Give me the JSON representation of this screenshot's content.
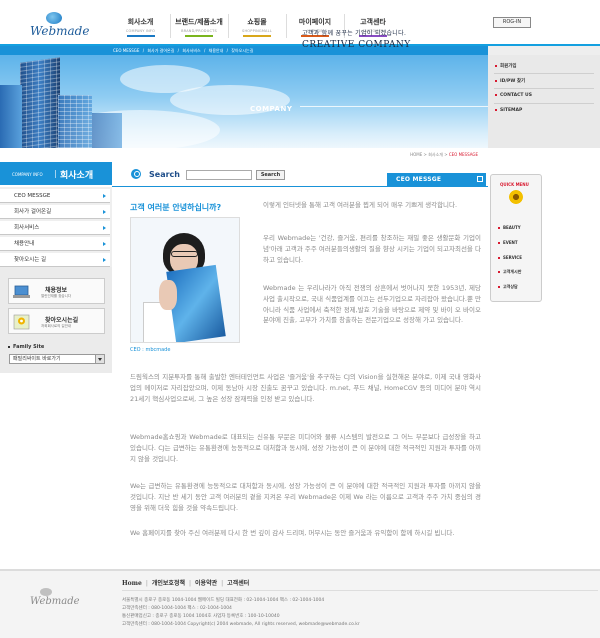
{
  "brand": {
    "logo_text": "Webmade"
  },
  "topnav": [
    {
      "ko": "회사소개",
      "en": "COMPANY INFO",
      "color": "#1a79c4"
    },
    {
      "ko": "브랜드/제품소개",
      "en": "BRAND/PRODUCTS",
      "color": "#7ab51d"
    },
    {
      "ko": "쇼핑몰",
      "en": "SHOPPINGMALL",
      "color": "#d8a71a"
    },
    {
      "ko": "마이페이지",
      "en": "MYPAGE",
      "color": "#d85a1a"
    },
    {
      "ko": "고객센타",
      "en": "CUSTOMER",
      "color": "#8a4dc4"
    }
  ],
  "login_label": "ROG-IN",
  "subnav": [
    "CEO MESSGE",
    "/",
    "회사가 걸어온길",
    "/",
    "회사서비스",
    "/",
    "채용안내",
    "/",
    "찾아오시는길"
  ],
  "banner": {
    "line1": "고객과 함께 꿈꾸는 기업이 되겠습니다.",
    "line2": "CREATIVE COMPANY",
    "company": "COMPANY"
  },
  "right_menu": [
    "회원가입",
    "ID/PW 찾기",
    "CONTACT US",
    "SITEMAP"
  ],
  "breadcrumb": {
    "home": "HOME",
    "sep": " > ",
    "mid": "회사소개",
    "current": "CEO MESSAGE"
  },
  "left": {
    "header_en": "COMPANY INFO",
    "header_ko": "회사소개",
    "menu": [
      "CEO MESSGE",
      "회사가 걸어온길",
      "회사서비스",
      "채용안내",
      "찾아오시는 길"
    ],
    "buttons": [
      {
        "title": "채용정보",
        "sub": "열린인재를 찾습니다"
      },
      {
        "title": "찾아오시는길",
        "sub": "저희회사로의 길안내"
      }
    ],
    "family_label": "Family Site",
    "family_value": "패밀리싸이트 바로가기"
  },
  "search": {
    "label": "Search",
    "placeholder": "",
    "button": "Search"
  },
  "ceo_tab": "CEO MESSGE",
  "content": {
    "greeting": "고객 여러분 안녕하십니까?",
    "caption": "CEO : mbcmade",
    "p1": "이렇게 인터넷을 통해 고객 여러분을 뵙게 되어 매우 기쁘게 생각합니다.",
    "p2": "우리 Webmade는 '건강, 즐거움, 편리를 창조하는 재밀 좋은 생활문화 기업이념'아래 고객과 주주 여러분들의생활의 질을 향상 시키는 기업이 되고자최선을 다하고 있습니다.",
    "p3": "Webmade 는 우리나라가 아직 전쟁의 상흔에서 벗어나지 못한 1953년, 제당사업 출시작으로, 국내 식품업계를 이끄는 선두기업으로 자리잡아 왔습니다.뿐 만 아니라 식품 사업에서 축적한 정제,발효 기술을 바탕으로 제약 및 바이 오 바이오 분야에 진출, 고부가 가치를 창출하는 전문기업으로 성장해 가고 있습니다.",
    "p4": "드림웍스의 지분투자를 통해 출발한 엔터테인먼트 사업은 '즐거움'을 추구하는 CJ의 Vision을 실현해온 분야로, 이제 국내 영화사업의 메이저로 자리잡았으며, 이제 동남아 시장 진출도 꿈꾸고 있습니다. m.net, 푸드 채널, HomeCGV 등의 미디어 분야 역시 21세기 핵심사업으로써, 그 높은 성장 잠재력을 인정 받고 있습니다.",
    "p5": "Webmade홈쇼핑과 Webmade로 대표되는 신유통 부문은 미디어와 물류 시스템의 발전으로 그 어느 부문보다 급성장을 하고 있습니다. CJ는 급변하는 유통환경에 능동적으로 대처함과 동시에, 성장 가능성이 큰 이 분야에 대한 적극적인 지원과 투자를 아끼지 않을 것입니다.",
    "p6": "We는 급변하는 유통환경에 능동적으로 대처함과 동시에, 성장 가능성이 큰 이 분야에 대한 적극적인 지원과 투자를 아끼지 않을 것입니다. 지난 반 세기 동안 고객 여러분의 곁을 지켜온 우리 Webmade은 이제 We 라는 이름으로 고객과 주주 가치 중심의 경영을 위해 더욱 힘을 것을 약속드립니다.",
    "p7": "We 홈페이지를 찾아 주신 여러분께 다시 한 번 깊이 감사 드리며, 머무시는 동안 즐거움과 유익함이 함께 하시길 빕니다."
  },
  "quick_menu": {
    "title": "QUICK MENU",
    "items": [
      "BEAUTY",
      "EVENT",
      "SERVICE",
      "고객게시판",
      "고객상담"
    ]
  },
  "footer": {
    "links": [
      "Home",
      "개인보호정책",
      "이용약관",
      "고객센터"
    ],
    "lines": [
      "서울특별시 종로구 종로동 1004-1004 웹메이드 빌딩   대표전화 : 02-1004-1004   팩스 : 02-1004-1004",
      "고객만족센터 : 080-1004-1004   팩스 : 02-1004-1004",
      "통신판매업신고 : 종로구 종로동 1004 1004호   사업자 등록번호 : 100-10-10040",
      "고객만족센터 : 080-1004-1004   Copyright(c) 2004 webmade, All rights reserved, webmade@webmade.co.kr"
    ]
  }
}
